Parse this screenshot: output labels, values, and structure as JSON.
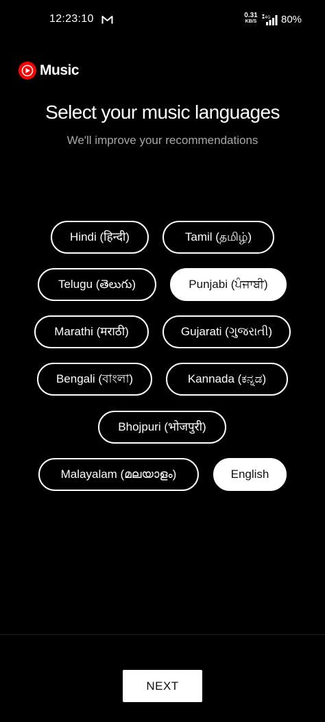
{
  "status_bar": {
    "time": "12:23:10",
    "net_speed_value": "0.31",
    "net_speed_unit": "KB/S",
    "battery": "80%",
    "icons": [
      "gmail-icon",
      "signal-icon"
    ]
  },
  "app": {
    "name": "Music",
    "brand_color": "#ff0000"
  },
  "header": {
    "title": "Select your music languages",
    "subtitle": "We'll improve your recommendations"
  },
  "languages": [
    {
      "label": "Hindi (हिन्दी)",
      "selected": false
    },
    {
      "label": "Tamil (தமிழ்)",
      "selected": false
    },
    {
      "label": "Telugu (తెలుగు)",
      "selected": false
    },
    {
      "label": "Punjabi (ਪੰਜਾਬੀ)",
      "selected": true
    },
    {
      "label": "Marathi (मराठी)",
      "selected": false
    },
    {
      "label": "Gujarati (ગુજરાતી)",
      "selected": false
    },
    {
      "label": "Bengali (বাংলা)",
      "selected": false
    },
    {
      "label": "Kannada (ಕನ್ನಡ)",
      "selected": false
    },
    {
      "label": "Bhojpuri (भोजपुरी)",
      "selected": false
    },
    {
      "label": "Malayalam (മലയാളം)",
      "selected": false
    },
    {
      "label": "English",
      "selected": true
    }
  ],
  "footer": {
    "next_label": "NEXT"
  }
}
